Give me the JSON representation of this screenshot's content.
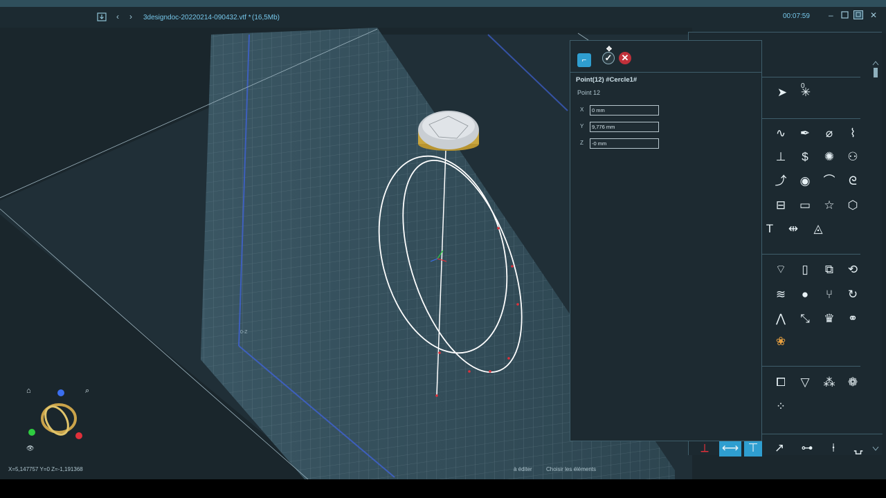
{
  "titlebar": {
    "file_name": "3designdoc-20220214-090432.vtf *",
    "file_size": "(16,5Mb)",
    "timer": "00:07:59",
    "icons": [
      "save-icon",
      "back-icon",
      "forward-icon",
      "minimize-icon",
      "maximize-icon",
      "restore-icon",
      "close-icon"
    ]
  },
  "viewport": {
    "plane_label": "0-Z"
  },
  "point_dialog": {
    "title": "Point(12) #Cercle1#",
    "subtitle": "Point 12",
    "fields": [
      {
        "label": "X",
        "value": "0 mm"
      },
      {
        "label": "Y",
        "value": "9,776 mm"
      },
      {
        "label": "Z",
        "value": "-0 mm"
      }
    ]
  },
  "palette": {
    "tools_row0": [
      "select-arrow-icon",
      "origin-axes-icon"
    ],
    "tools_row0_label": "0",
    "colors": {
      "accent": "#2f9ed0",
      "close": "#c0303a",
      "background": "#1c2930"
    }
  },
  "status": {
    "coords": "X=5,147757  Y=0  Z=-1,191368",
    "hint_left": "à éditer",
    "hint_right": "Choisir les éléments"
  }
}
